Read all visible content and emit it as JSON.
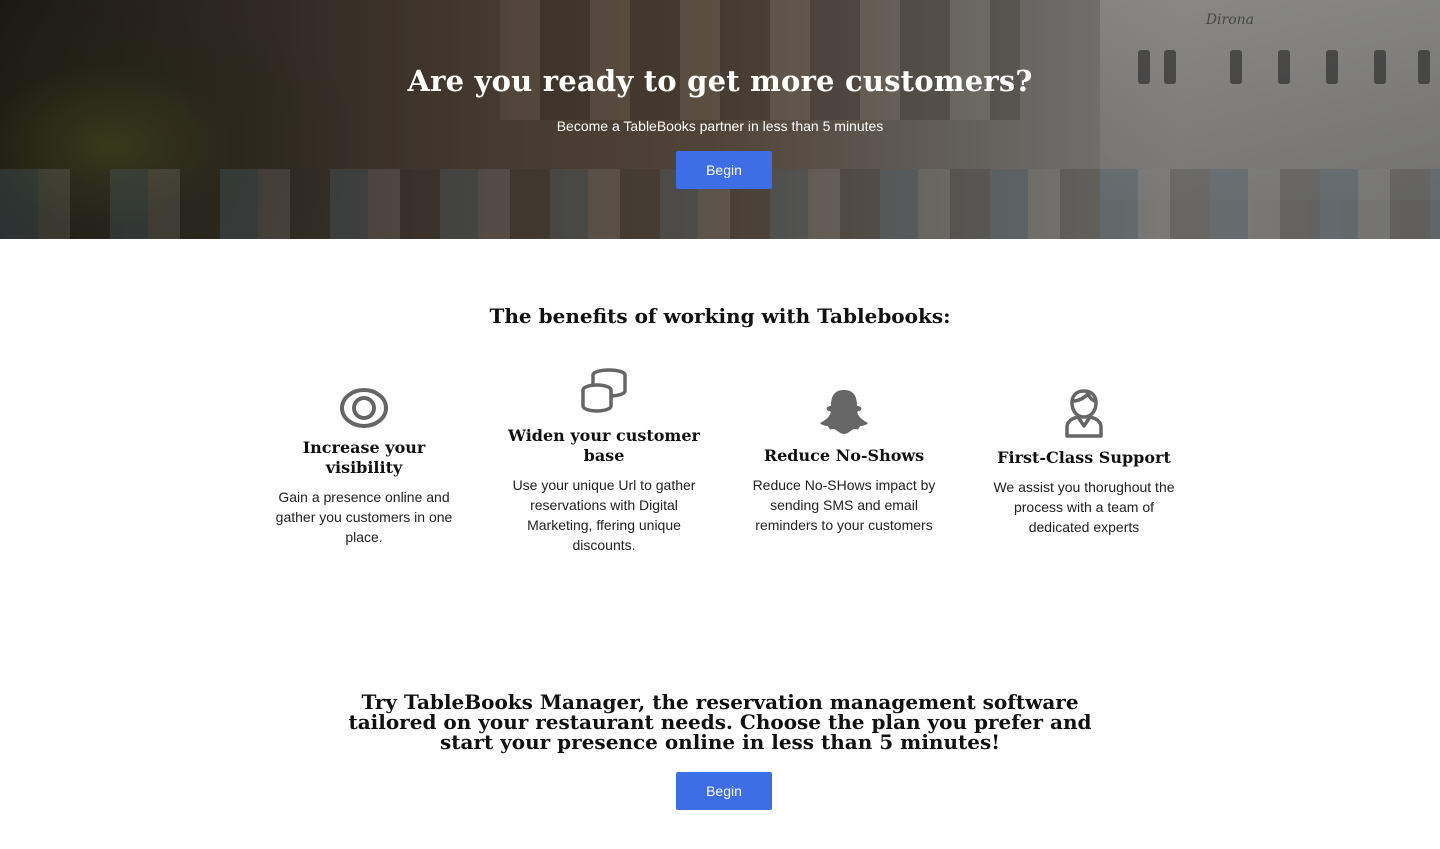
{
  "hero": {
    "title": "Are you ready to get more customers?",
    "subtitle": "Become a TableBooks partner in less than 5 minutes",
    "button_label": "Begin",
    "background_text": "Dirona"
  },
  "benefits": {
    "title": "The benefits of working with Tablebooks:",
    "items": [
      {
        "icon": "eye-icon",
        "title": "Increase your visibility",
        "text": "Gain a presence online and gather you customers in one place."
      },
      {
        "icon": "coins-icon",
        "title": "Widen your customer base",
        "text": "Use your unique Url to gather reservations with Digital Marketing, ffering unique discounts."
      },
      {
        "icon": "ghost-icon",
        "title": "Reduce No-Shows",
        "text": "Reduce No-SHows impact by sending SMS and email reminders to your customers"
      },
      {
        "icon": "support-person-icon",
        "title": "First-Class Support",
        "text": "We assist you thorughout the process with a team of dedicated experts"
      }
    ]
  },
  "cta": {
    "title": "Try TableBooks Manager, the reservation management software tailored on your restaurant needs. Choose the plan you prefer and start your presence online in less than 5 minutes!",
    "button_label": "Begin"
  },
  "colors": {
    "accent": "#3e6ee6",
    "icon": "#666666",
    "text": "#111111"
  }
}
